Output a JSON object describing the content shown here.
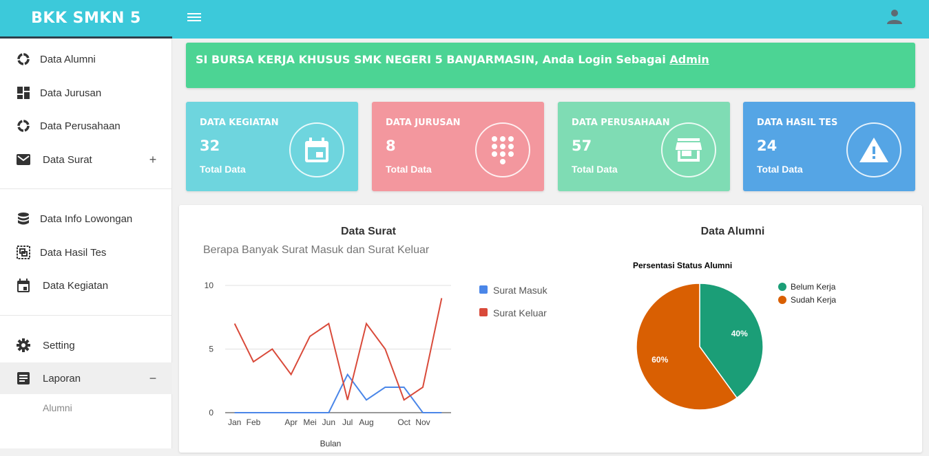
{
  "app": {
    "brand": "BKK SMKN 5"
  },
  "banner": {
    "text": "SI BURSA KERJA KHUSUS SMK NEGERI 5 BANJARMASIN, Anda Login Sebagai ",
    "user": "Admin"
  },
  "sidebar": {
    "items": [
      {
        "label": "Data Alumni",
        "icon": "pie-icon"
      },
      {
        "label": "Data Jurusan",
        "icon": "dashboard-icon"
      },
      {
        "label": "Data Perusahaan",
        "icon": "pie-icon"
      },
      {
        "label": "Data Surat",
        "icon": "mail-icon",
        "toggle": "+"
      },
      {
        "label": "Data Info Lowongan",
        "icon": "database-icon"
      },
      {
        "label": "Data Hasil Tes",
        "icon": "select-icon"
      },
      {
        "label": "Data Kegiatan",
        "icon": "calendar-icon"
      },
      {
        "label": "Setting",
        "icon": "gear-icon"
      },
      {
        "label": "Laporan",
        "icon": "report-icon",
        "toggle": "−"
      }
    ],
    "sub_items": [
      "Alumni"
    ]
  },
  "cards": [
    {
      "title": "DATA KEGIATAN",
      "value": "32",
      "sub": "Total Data",
      "color": "#6ed5de",
      "icon": "calendar-icon"
    },
    {
      "title": "DATA JURUSAN",
      "value": "8",
      "sub": "Total Data",
      "color": "#f3979e",
      "icon": "dialpad-icon"
    },
    {
      "title": "DATA PERUSAHAAN",
      "value": "57",
      "sub": "Total Data",
      "color": "#7fdcb4",
      "icon": "store-icon"
    },
    {
      "title": "DATA HASIL TES",
      "value": "24",
      "sub": "Total Data",
      "color": "#55a5e5",
      "icon": "warning-icon"
    }
  ],
  "chart_data": [
    {
      "type": "line",
      "title": "Data Surat",
      "subtitle": "Berapa Banyak Surat Masuk dan Surat Keluar",
      "xlabel": "Bulan",
      "ylabel": "",
      "ylim": [
        0,
        10
      ],
      "yticks": [
        "0",
        "5",
        "10"
      ],
      "x": [
        1,
        2,
        3,
        4,
        5,
        6,
        7,
        8,
        9,
        10,
        11,
        12
      ],
      "xtick_labels": [
        "Jan",
        "Feb",
        "Apr",
        "Mei",
        "Jun",
        "Jul",
        "Aug",
        "Oct",
        "Nov"
      ],
      "xtick_positions": [
        1,
        2,
        4,
        5,
        6,
        7,
        8,
        10,
        11
      ],
      "legend_position": "right",
      "series": [
        {
          "name": "Surat Masuk",
          "color": "#4a86e8",
          "values": [
            0,
            0,
            0,
            0,
            0,
            0,
            3,
            1,
            2,
            2,
            0,
            0
          ]
        },
        {
          "name": "Surat Keluar",
          "color": "#d94a3a",
          "values": [
            7,
            4,
            5,
            3,
            6,
            7,
            1,
            7,
            5,
            1,
            2,
            9
          ]
        }
      ]
    },
    {
      "type": "pie",
      "title": "Data Alumni",
      "subtitle": "Persentasi Status Alumni",
      "legend_position": "top-right",
      "slices": [
        {
          "label": "Belum Kerja",
          "value": 40,
          "display": "40%",
          "color": "#1b9e77"
        },
        {
          "label": "Sudah Kerja",
          "value": 60,
          "display": "60%",
          "color": "#d95f02"
        }
      ]
    }
  ]
}
